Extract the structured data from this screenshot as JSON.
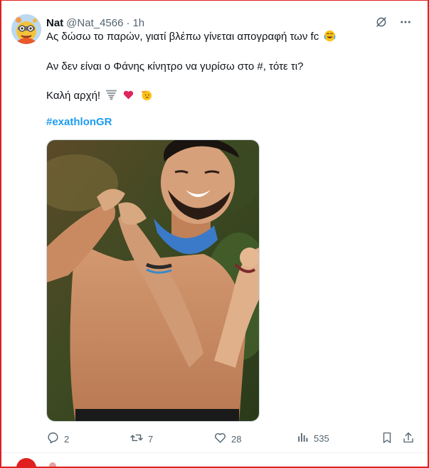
{
  "tweet": {
    "author_name": "Nat",
    "author_handle": "@Nat_4566",
    "separator": "·",
    "time": "1h",
    "line1": "Ας δώσω το παρών, γιατί βλέπω γίνεται απογραφή των fc",
    "line2": "Αν δεν είναι ο Φάνης κίνητρο να γυρίσω στο #, τότε τι?",
    "line3": "Καλή αρχή!",
    "hashtag": "#exathlonGR",
    "emojis": [
      "joy-emoji",
      "tornado-emoji",
      "red-heart-emoji",
      "saluting-face-emoji"
    ]
  },
  "actions": {
    "replies": "2",
    "reposts": "7",
    "likes": "28",
    "views": "535"
  },
  "icons": [
    "grok-icon",
    "more-icon",
    "reply-icon",
    "repost-icon",
    "like-icon",
    "views-icon",
    "bookmark-icon",
    "share-icon"
  ],
  "colors": {
    "accent": "#1d9bf0",
    "muted": "#536471",
    "text": "#0f1419",
    "frame": "#e0201e"
  }
}
